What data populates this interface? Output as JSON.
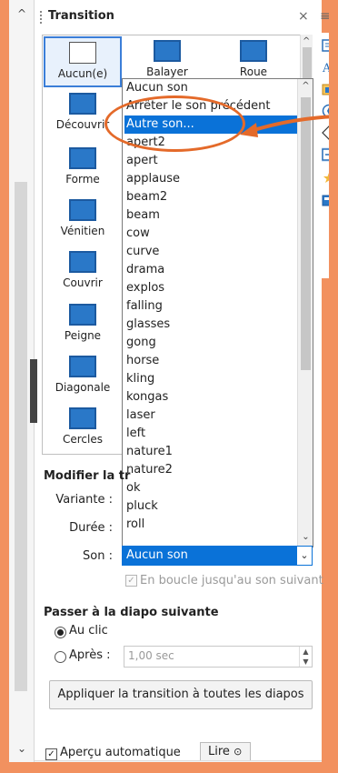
{
  "panel": {
    "title": "Transition",
    "close_glyph": "×",
    "menu_glyph": "≡"
  },
  "transitions": [
    {
      "label": "Aucun(e)",
      "icon": "none-icon",
      "selected": true
    },
    {
      "label": "Balayer",
      "icon": "wipe-icon"
    },
    {
      "label": "Roue",
      "icon": "wheel-icon"
    },
    {
      "label": "Découvrir",
      "icon": "uncover-icon"
    },
    {
      "label": "Forme",
      "icon": "shape-icon"
    },
    {
      "label": "Vénitien",
      "icon": "venetian-icon"
    },
    {
      "label": "Couvrir",
      "icon": "cover-icon"
    },
    {
      "label": "Peigne",
      "icon": "comb-icon"
    },
    {
      "label": "Diagonale",
      "icon": "diagonal-icon"
    },
    {
      "label": "Cercles",
      "icon": "circles-icon"
    }
  ],
  "sound_list": {
    "items": [
      "Aucun son",
      "Arrêter le son précédent",
      "Autre son...",
      "apert2",
      "apert",
      "applause",
      "beam2",
      "beam",
      "cow",
      "curve",
      "drama",
      "explos",
      "falling",
      "glasses",
      "gong",
      "horse",
      "kling",
      "kongas",
      "laser",
      "left",
      "nature1",
      "nature2",
      "ok",
      "pluck",
      "roll"
    ],
    "highlighted": "Autre son..."
  },
  "modify": {
    "title": "Modifier la tr",
    "variant_label": "Variante :",
    "duration_label": "Durée :",
    "sound_label": "Son :",
    "sound_value": "Aucun son",
    "loop_label": "En boucle jusqu'au son suivant",
    "loop_checked": false
  },
  "advance": {
    "title": "Passer à la diapo suivante",
    "on_click_label": "Au clic",
    "after_label": "Après :",
    "after_value": "1,00 sec",
    "selected": "on_click"
  },
  "apply_all_label": "Appliquer la transition à toutes les diapos",
  "preview": {
    "auto_label": "Aperçu automatique",
    "auto_checked": true,
    "play_label": "Lire"
  },
  "colors": {
    "accent": "#0a72d8",
    "annotation": "#e46a2a",
    "background": "#f2915f"
  }
}
